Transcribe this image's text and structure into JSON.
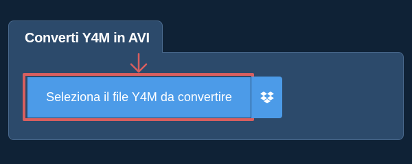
{
  "converter": {
    "tab_title": "Converti Y4M in AVI",
    "select_button_label": "Seleziona il file Y4M da convertire",
    "dropbox_icon": "dropbox-icon"
  },
  "colors": {
    "background": "#0f2236",
    "panel": "#2c4a6b",
    "button": "#4c9be8",
    "highlight": "#d95f5f"
  }
}
